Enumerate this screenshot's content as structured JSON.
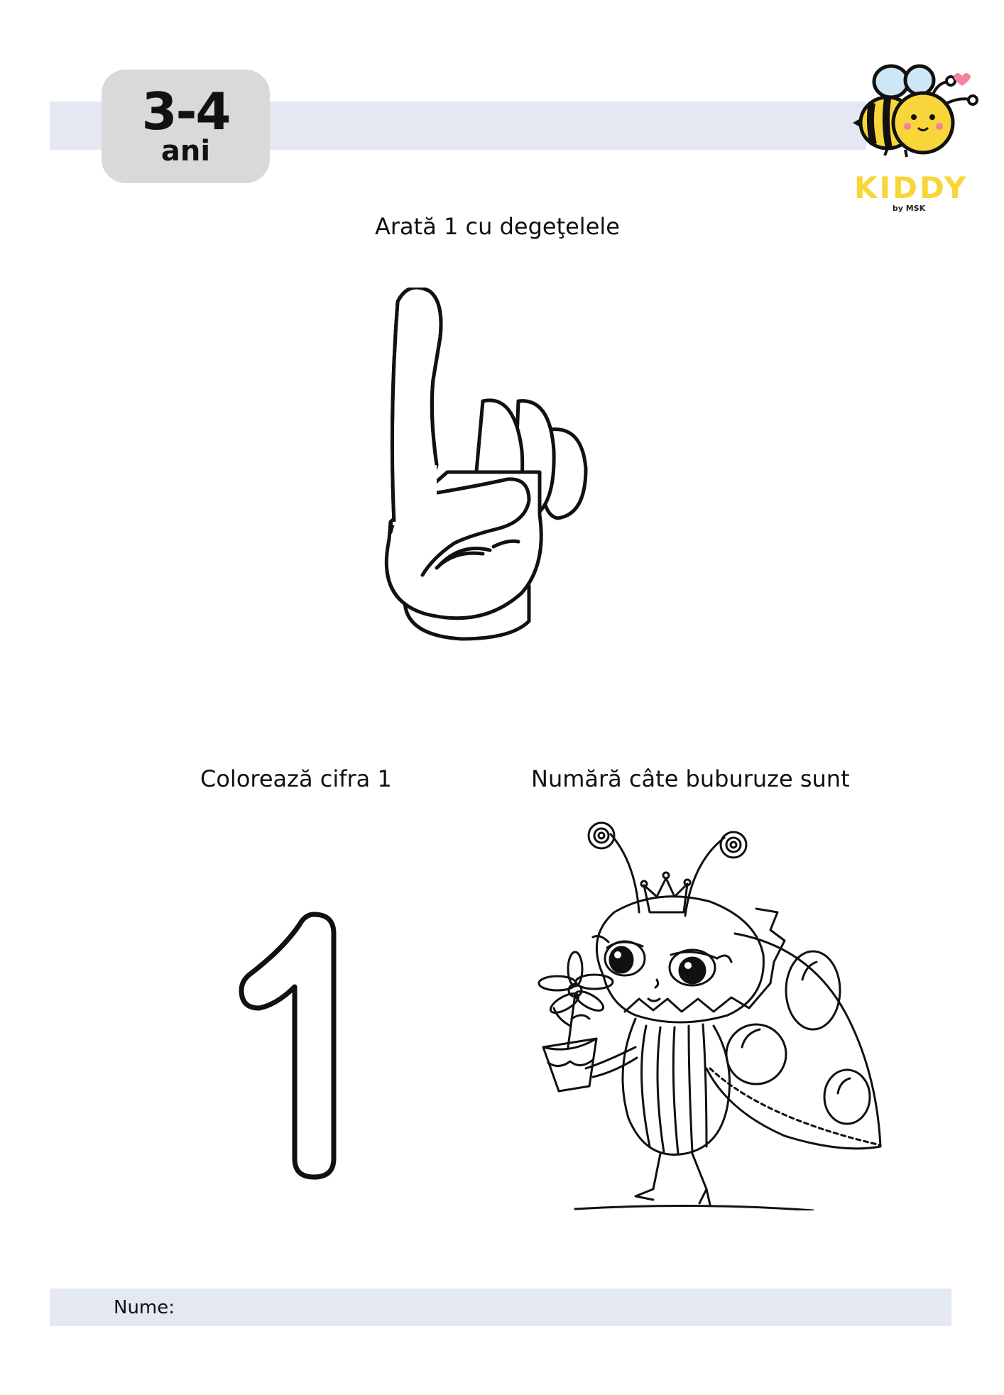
{
  "header": {
    "age_range": "3-4",
    "age_unit": "ani",
    "logo_name": "KIDDY",
    "logo_sub": "by MSK"
  },
  "sections": {
    "show_fingers": "Arată 1 cu degeţelele",
    "color_digit": "Colorează cifra 1",
    "count_ladybugs": "Numără câte buburuze sunt",
    "digit": "1"
  },
  "footer": {
    "name_label": "Nume:"
  },
  "colors": {
    "band": "#e4e8f2",
    "badge": "#d9d9d9",
    "logo_yellow": "#f8d63a"
  },
  "icons": {
    "logo": "bee-icon",
    "hand": "pointing-finger-icon",
    "digit": "digit-one-outline-icon",
    "ladybug": "ladybug-queen-icon"
  }
}
